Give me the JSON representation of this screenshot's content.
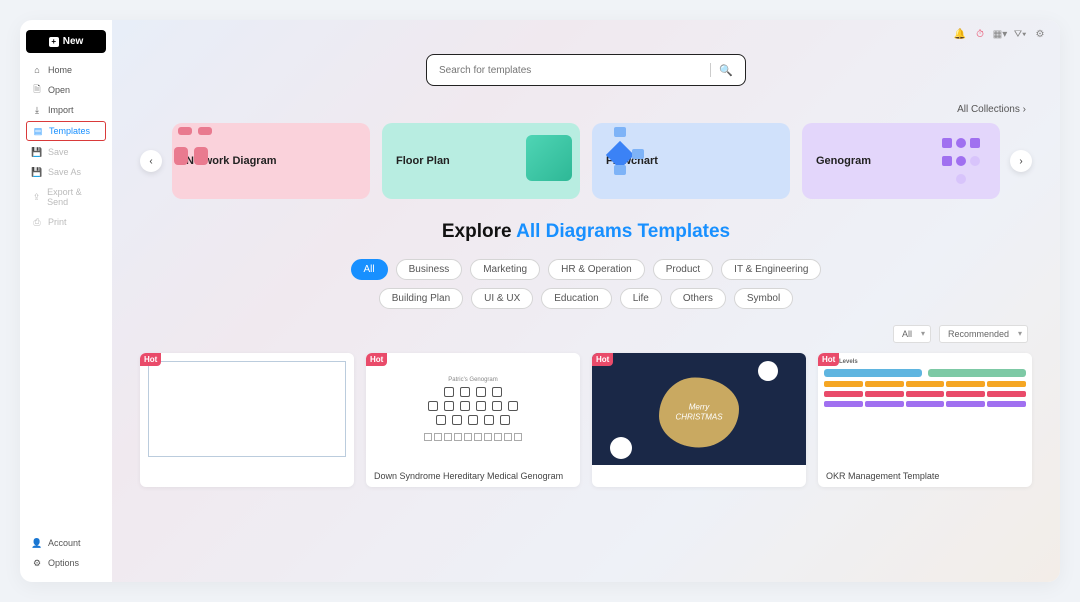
{
  "sidebar": {
    "new_label": "New",
    "items": [
      {
        "label": "Home",
        "icon": "home-icon"
      },
      {
        "label": "Open",
        "icon": "file-icon"
      },
      {
        "label": "Import",
        "icon": "import-icon"
      },
      {
        "label": "Templates",
        "icon": "template-icon",
        "active": true
      },
      {
        "label": "Save",
        "icon": "save-icon",
        "disabled": true
      },
      {
        "label": "Save As",
        "icon": "save-as-icon",
        "disabled": true
      },
      {
        "label": "Export & Send",
        "icon": "export-icon",
        "disabled": true
      },
      {
        "label": "Print",
        "icon": "print-icon",
        "disabled": true
      }
    ],
    "bottom": [
      {
        "label": "Account",
        "icon": "user-icon"
      },
      {
        "label": "Options",
        "icon": "gear-icon"
      }
    ]
  },
  "search": {
    "placeholder": "Search for templates"
  },
  "all_collections_label": "All Collections",
  "categories": [
    {
      "label": "Network Diagram"
    },
    {
      "label": "Floor  Plan"
    },
    {
      "label": "Flowchart"
    },
    {
      "label": "Genogram"
    }
  ],
  "explore": {
    "prefix": "Explore ",
    "highlight": "All Diagrams Templates"
  },
  "filters": [
    "All",
    "Business",
    "Marketing",
    "HR & Operation",
    "Product",
    "IT & Engineering",
    "Building Plan",
    "UI & UX",
    "Education",
    "Life",
    "Others",
    "Symbol"
  ],
  "active_filter": "All",
  "sort": {
    "filter_value": "All",
    "sort_value": "Recommended"
  },
  "badges": {
    "hot": "Hot"
  },
  "templates": [
    {
      "title": ""
    },
    {
      "title": "Down Syndrome Hereditary Medical Genogram"
    },
    {
      "greeting_line1": "Merry",
      "greeting_line2": "CHRISTMAS"
    },
    {
      "title": "OKR Management Template"
    }
  ]
}
